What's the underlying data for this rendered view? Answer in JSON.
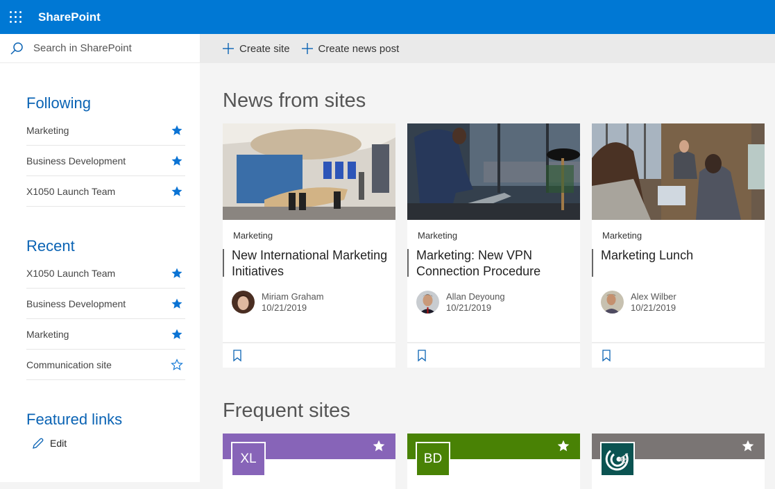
{
  "app": {
    "title": "SharePoint",
    "waffle_icon": "app-launcher-icon"
  },
  "search": {
    "placeholder": "Search in SharePoint",
    "icon": "search-icon"
  },
  "commands": [
    {
      "label": "Create site",
      "icon": "plus-icon"
    },
    {
      "label": "Create news post",
      "icon": "plus-icon"
    }
  ],
  "sidebar": {
    "following": {
      "title": "Following",
      "items": [
        {
          "label": "Marketing",
          "starred": true
        },
        {
          "label": "Business Development",
          "starred": true
        },
        {
          "label": "X1050 Launch Team",
          "starred": true
        }
      ]
    },
    "recent": {
      "title": "Recent",
      "items": [
        {
          "label": "X1050 Launch Team",
          "starred": true
        },
        {
          "label": "Business Development",
          "starred": true
        },
        {
          "label": "Marketing",
          "starred": true
        },
        {
          "label": "Communication site",
          "starred": false
        }
      ]
    },
    "featured": {
      "title": "Featured links",
      "edit_label": "Edit"
    }
  },
  "news": {
    "title": "News from sites",
    "cards": [
      {
        "category": "Marketing",
        "title": "New International Marketing Initiatives",
        "author": "Miriam Graham",
        "date": "10/21/2019",
        "image": "conference-room-photo"
      },
      {
        "category": "Marketing",
        "title": "Marketing: New VPN Connection Procedure",
        "author": "Allan Deyoung",
        "date": "10/21/2019",
        "image": "man-with-laptop-photo"
      },
      {
        "category": "Marketing",
        "title": "Marketing Lunch",
        "author": "Alex Wilber",
        "date": "10/21/2019",
        "image": "meeting-photo"
      }
    ]
  },
  "frequent": {
    "title": "Frequent sites",
    "sites": [
      {
        "initials": "XL",
        "color": "#8764b8",
        "starred": true
      },
      {
        "initials": "BD",
        "color": "#498205",
        "starred": true
      },
      {
        "initials": "",
        "color": "#7a7574",
        "logo_color": "#0b5351",
        "logo_icon": "target-icon",
        "starred": true
      }
    ]
  },
  "colors": {
    "brand": "#0078d4",
    "link": "#0a63b4"
  }
}
